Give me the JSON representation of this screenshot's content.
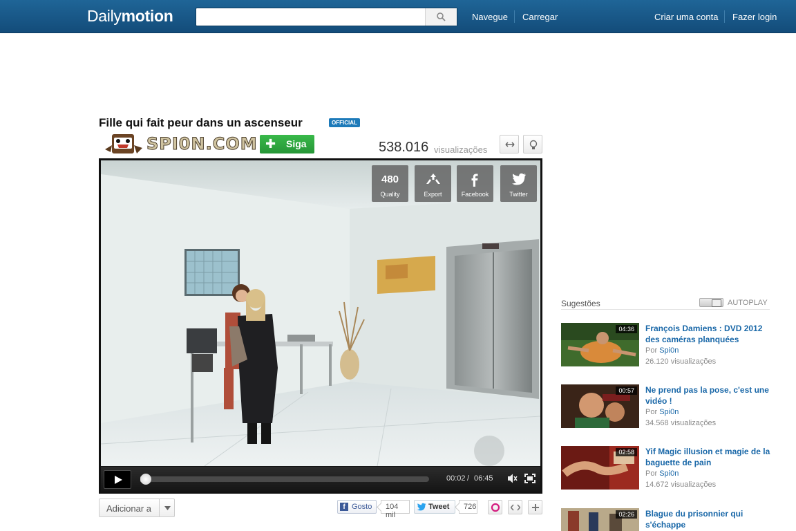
{
  "header": {
    "logo_light": "Daily",
    "logo_bold": "motion",
    "search_placeholder": "",
    "nav": {
      "browse": "Navegue",
      "upload": "Carregar",
      "signup": "Criar uma conta",
      "login": "Fazer login"
    }
  },
  "video": {
    "title": "Fille qui fait peur dans un ascenseur",
    "badge": "OFFICIAL",
    "channel_logo_text": "SPI0N.COM",
    "follow_label": "Siga",
    "views": "538.016",
    "views_label": "visualizações"
  },
  "player": {
    "overlay": [
      {
        "main": "480",
        "label": "Quality"
      },
      {
        "label": "Export"
      },
      {
        "label": "Facebook"
      },
      {
        "label": "Twitter"
      }
    ],
    "time_current": "00:02",
    "time_total": "06:45",
    "progress": 0.005
  },
  "actions": {
    "add_to": "Adicionar a",
    "like": "Gosto",
    "like_count": "104 mil",
    "tweet": "Tweet",
    "tweet_count": "726"
  },
  "suggestions": {
    "title": "Sugestões",
    "autoplay": "AUTOPLAY",
    "by": "Por",
    "items": [
      {
        "title": "François Damiens : DVD 2012 des caméras planquées",
        "duration": "04:36",
        "channel": "Spi0n",
        "views": "26.120 visualizações"
      },
      {
        "title": "Ne prend pas la pose, c'est une vidéo !",
        "duration": "00:57",
        "channel": "Spi0n",
        "views": "34.568 visualizações"
      },
      {
        "title": "Yif Magic illusion et magie de la baguette de pain",
        "duration": "02:58",
        "channel": "Spi0n",
        "views": "14.672 visualizações"
      },
      {
        "title": "Blague du prisonnier qui s'échappe",
        "duration": "02:26",
        "channel": "",
        "views": ""
      }
    ]
  },
  "colors": {
    "header": "#1a5a8a",
    "link": "#1a68a8",
    "follow": "#2fa941"
  }
}
